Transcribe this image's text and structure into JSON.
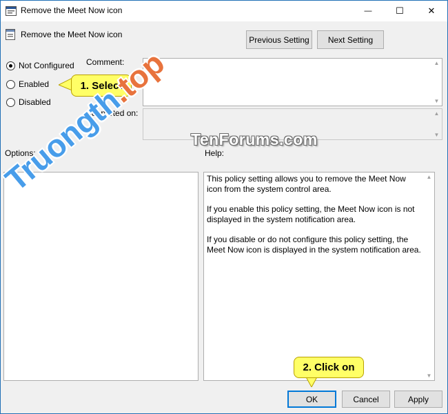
{
  "window": {
    "title": "Remove the Meet Now icon",
    "controls": {
      "minimize": "—",
      "maximize": "☐",
      "close": "✕"
    }
  },
  "header": {
    "policy_name": "Remove the Meet Now icon",
    "previous_label": "Previous Setting",
    "next_label": "Next Setting"
  },
  "state": {
    "options": [
      {
        "label": "Not Configured",
        "selected": true
      },
      {
        "label": "Enabled",
        "selected": false
      },
      {
        "label": "Disabled",
        "selected": false
      }
    ]
  },
  "fields": {
    "comment_label": "Comment:",
    "comment_value": "",
    "supported_label": "Supported on:",
    "supported_value": ""
  },
  "panes": {
    "options_label": "Options:",
    "help_label": "Help:",
    "help_paragraphs": [
      "This policy setting allows you to remove the Meet Now icon from the system control area.",
      "If you enable this policy setting, the Meet Now icon is not displayed in the system notification area.",
      "If you disable or do not configure this policy setting, the Meet Now icon is displayed in the system notification area."
    ]
  },
  "footer": {
    "ok_label": "OK",
    "cancel_label": "Cancel",
    "apply_label": "Apply"
  },
  "annotations": {
    "step1": "1. Select",
    "step2": "2. Click on"
  },
  "watermarks": {
    "tenforums": "TenForums.com",
    "site_main": "Truongth",
    "site_accent": ".top"
  },
  "colors": {
    "accent": "#0078d7",
    "callout": "#ffff66",
    "watermark_blue": "#288ce6",
    "watermark_orange": "#e66428"
  }
}
